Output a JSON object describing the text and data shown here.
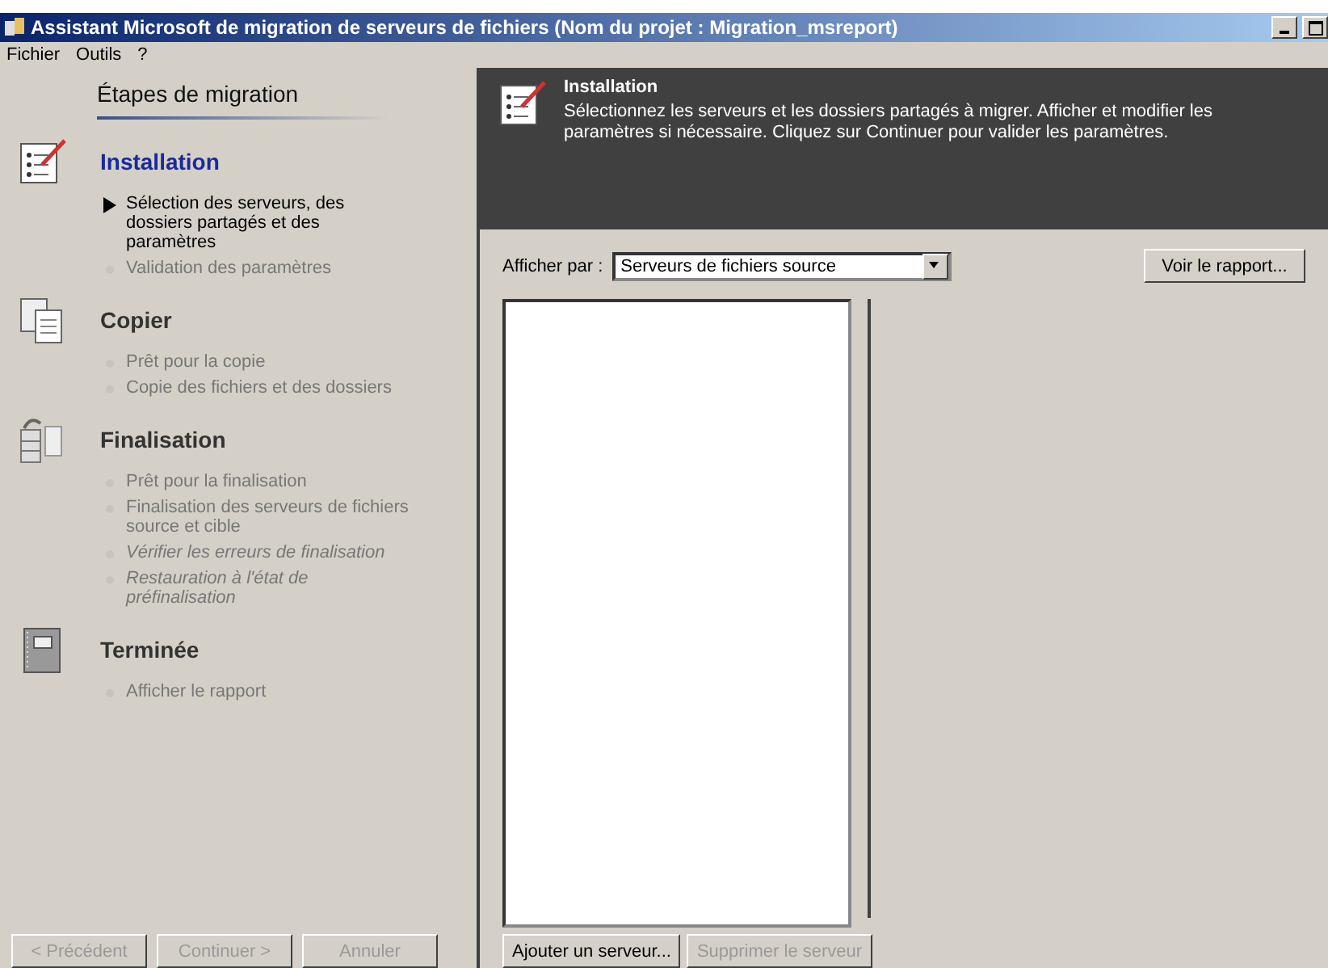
{
  "window": {
    "title": "Assistant Microsoft de migration de serveurs de fichiers (Nom du projet : Migration_msreport)"
  },
  "menu": [
    "Fichier",
    "Outils",
    "?"
  ],
  "sidebar": {
    "title": "Étapes de migration",
    "sections": [
      {
        "title": "Installation",
        "kind": "checklist",
        "active": true,
        "items": [
          {
            "label": "Sélection des serveurs, des dossiers partagés et des paramètres",
            "current": true,
            "optional": false
          },
          {
            "label": "Validation des paramètres",
            "current": false,
            "optional": false
          }
        ]
      },
      {
        "title": "Copier",
        "kind": "copy",
        "active": false,
        "items": [
          {
            "label": "Prêt pour la copie",
            "current": false,
            "optional": false
          },
          {
            "label": "Copie des fichiers et des dossiers",
            "current": false,
            "optional": false
          }
        ]
      },
      {
        "title": "Finalisation",
        "kind": "server",
        "active": false,
        "items": [
          {
            "label": "Prêt pour la finalisation",
            "current": false,
            "optional": false
          },
          {
            "label": "Finalisation des serveurs de fichiers source et cible",
            "current": false,
            "optional": false
          },
          {
            "label": "Vérifier les erreurs de finalisation",
            "current": false,
            "optional": true
          },
          {
            "label": "Restauration à l'état de préfinalisation",
            "current": false,
            "optional": true
          }
        ]
      },
      {
        "title": "Terminée",
        "kind": "notebook",
        "active": false,
        "items": [
          {
            "label": "Afficher le rapport",
            "current": false,
            "optional": false
          }
        ]
      }
    ],
    "buttons": [
      {
        "label": "< Précédent",
        "disabled": true
      },
      {
        "label": "Continuer >",
        "disabled": true
      },
      {
        "label": "Annuler",
        "disabled": true
      }
    ]
  },
  "header": {
    "title": "Installation",
    "description": "Sélectionnez les serveurs et les dossiers partagés à migrer. Afficher et modifier les paramètres si nécessaire. Cliquez sur Continuer pour valider les paramètres."
  },
  "view_by": {
    "label": "Afficher par :",
    "value": "Serveurs de fichiers source"
  },
  "report_button": {
    "label": "Voir le rapport...",
    "disabled": false
  },
  "server_buttons": [
    {
      "label": "Ajouter un serveur...",
      "disabled": false
    },
    {
      "label": "Supprimer le serveur",
      "disabled": true
    }
  ]
}
